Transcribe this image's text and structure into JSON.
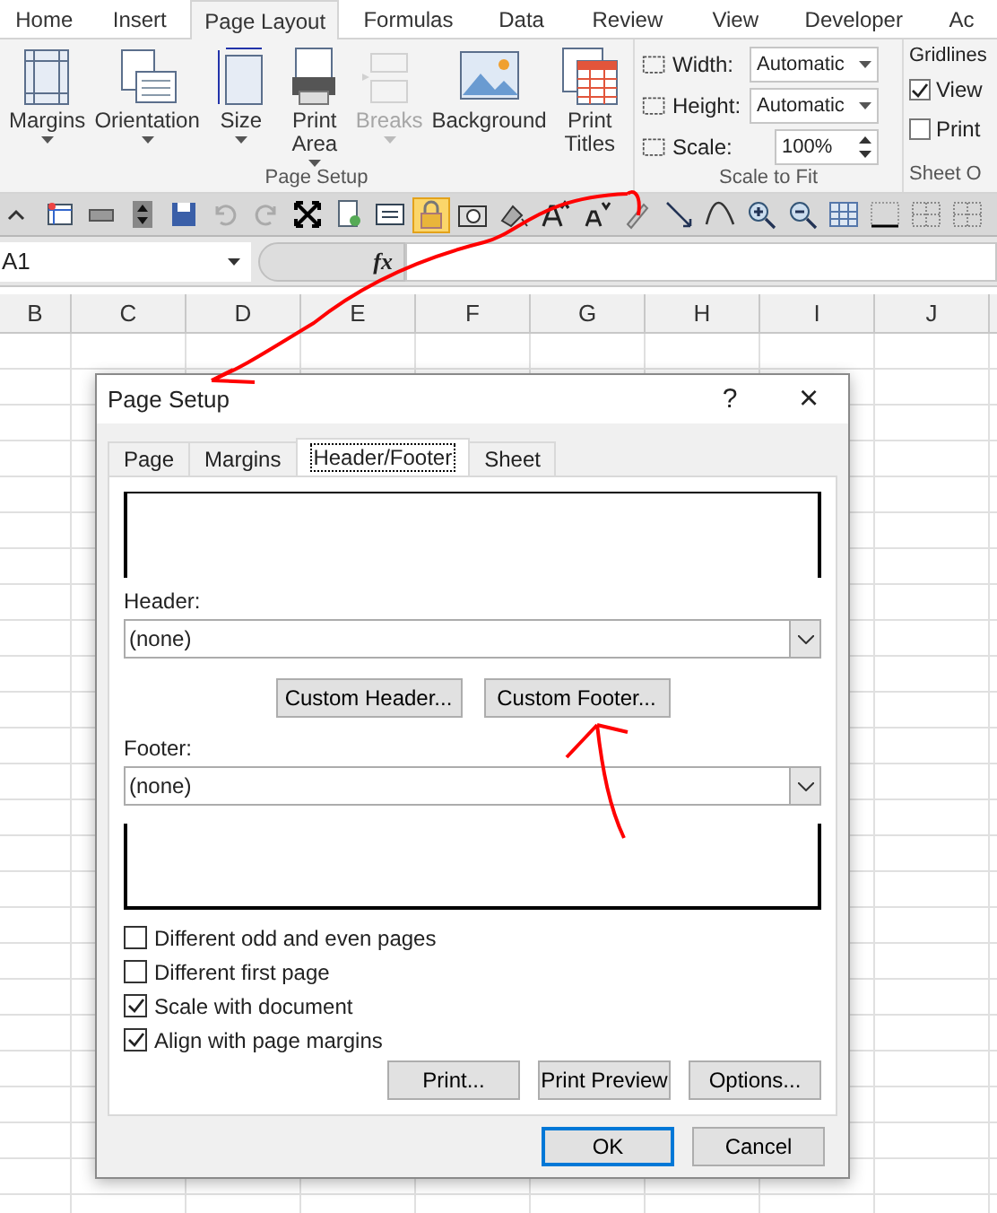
{
  "ribbon_tabs": [
    {
      "label": "Home",
      "selected": false
    },
    {
      "label": "Insert",
      "selected": false
    },
    {
      "label": "Page Layout",
      "selected": true
    },
    {
      "label": "Formulas",
      "selected": false
    },
    {
      "label": "Data",
      "selected": false
    },
    {
      "label": "Review",
      "selected": false
    },
    {
      "label": "View",
      "selected": false
    },
    {
      "label": "Developer",
      "selected": false
    },
    {
      "label": "Ac",
      "selected": false
    }
  ],
  "page_setup_group": {
    "label": "Page Setup",
    "buttons": [
      {
        "kind": "margins",
        "label": "Margins",
        "disabled": false,
        "dropdown": true
      },
      {
        "kind": "orientation",
        "label": "Orientation",
        "disabled": false,
        "dropdown": true
      },
      {
        "kind": "size",
        "label": "Size",
        "disabled": false,
        "dropdown": true
      },
      {
        "kind": "print_area",
        "label": "Print Area",
        "disabled": false,
        "dropdown": true
      },
      {
        "kind": "breaks",
        "label": "Breaks",
        "disabled": true,
        "dropdown": true
      },
      {
        "kind": "background",
        "label": "Background",
        "disabled": false,
        "dropdown": false
      },
      {
        "kind": "print_titles",
        "label": "Print Titles",
        "disabled": false,
        "dropdown": false
      }
    ]
  },
  "scale_to_fit_group": {
    "label": "Scale to Fit",
    "fields": [
      {
        "kind": "dropdown",
        "label": "Width:",
        "value": "Automatic"
      },
      {
        "kind": "dropdown",
        "label": "Height:",
        "value": "Automatic"
      },
      {
        "kind": "spinner",
        "label": "Scale:",
        "value": "100%"
      }
    ]
  },
  "sheet_options_group": {
    "label": "Sheet O",
    "heading": "Gridlines",
    "options": [
      {
        "label": "View",
        "checked": true
      },
      {
        "label": "Print",
        "checked": false
      }
    ]
  },
  "toolbar": [
    {
      "kind": "caret",
      "selected": false
    },
    {
      "kind": "form",
      "selected": false
    },
    {
      "kind": "bar",
      "selected": false
    },
    {
      "kind": "updown",
      "selected": false
    },
    {
      "kind": "save",
      "selected": false
    },
    {
      "kind": "undo",
      "selected": false
    },
    {
      "kind": "redo",
      "selected": false
    },
    {
      "kind": "fit",
      "selected": false
    },
    {
      "kind": "doc",
      "selected": false
    },
    {
      "kind": "textbox",
      "selected": false
    },
    {
      "kind": "lock",
      "selected": true
    },
    {
      "kind": "camera",
      "selected": false
    },
    {
      "kind": "paint",
      "selected": false
    },
    {
      "kind": "fontup",
      "selected": false
    },
    {
      "kind": "fontdown",
      "selected": false
    },
    {
      "kind": "pen",
      "selected": false
    },
    {
      "kind": "line",
      "selected": false
    },
    {
      "kind": "curve",
      "selected": false
    },
    {
      "kind": "zoomin",
      "selected": false
    },
    {
      "kind": "zoomout",
      "selected": false
    },
    {
      "kind": "table",
      "selected": false
    },
    {
      "kind": "border",
      "selected": false
    },
    {
      "kind": "grid",
      "selected": false
    },
    {
      "kind": "grid",
      "selected": false
    }
  ],
  "formula_bar": {
    "name_box": "A1",
    "fx": "fx"
  },
  "columns": [
    "B",
    "C",
    "D",
    "E",
    "F",
    "G",
    "H",
    "I",
    "J"
  ],
  "dialog": {
    "title": "Page Setup",
    "help": "?",
    "close": "×",
    "tabs": [
      {
        "label": "Page",
        "selected": false
      },
      {
        "label": "Margins",
        "selected": false
      },
      {
        "label": "Header/Footer",
        "selected": true
      },
      {
        "label": "Sheet",
        "selected": false
      }
    ],
    "header_label": "Header:",
    "header_value": "(none)",
    "custom_buttons": [
      "Custom Header...",
      "Custom Footer..."
    ],
    "footer_label": "Footer:",
    "footer_value": "(none)",
    "options": [
      {
        "label": "Different odd and even pages",
        "checked": false
      },
      {
        "label": "Different first page",
        "checked": false
      },
      {
        "label": "Scale with document",
        "checked": true
      },
      {
        "label": "Align with page margins",
        "checked": true
      }
    ],
    "action_buttons": [
      "Print...",
      "Print Preview",
      "Options..."
    ],
    "footer_buttons": [
      {
        "label": "OK",
        "default": true
      },
      {
        "label": "Cancel",
        "default": false
      }
    ]
  }
}
